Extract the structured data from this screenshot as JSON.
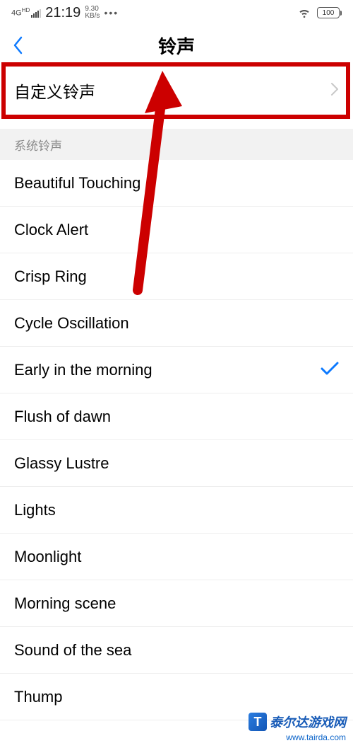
{
  "statusBar": {
    "network": "4G",
    "hd": "HD",
    "time": "21:19",
    "speedValue": "9.30",
    "speedUnit": "KB/s",
    "dots": "•••",
    "battery": "100"
  },
  "nav": {
    "title": "铃声"
  },
  "customRow": {
    "label": "自定义铃声"
  },
  "sectionHeader": "系统铃声",
  "ringtones": [
    {
      "label": "Beautiful Touching",
      "selected": false
    },
    {
      "label": "Clock Alert",
      "selected": false
    },
    {
      "label": "Crisp Ring",
      "selected": false
    },
    {
      "label": "Cycle Oscillation",
      "selected": false
    },
    {
      "label": "Early in the morning",
      "selected": true
    },
    {
      "label": "Flush of dawn",
      "selected": false
    },
    {
      "label": "Glassy Lustre",
      "selected": false
    },
    {
      "label": "Lights",
      "selected": false
    },
    {
      "label": "Moonlight",
      "selected": false
    },
    {
      "label": "Morning scene",
      "selected": false
    },
    {
      "label": "Sound of the sea",
      "selected": false
    },
    {
      "label": "Thump",
      "selected": false
    }
  ],
  "watermark": {
    "logoLetter": "T",
    "name": "泰尔达游戏网",
    "url": "www.tairda.com"
  }
}
